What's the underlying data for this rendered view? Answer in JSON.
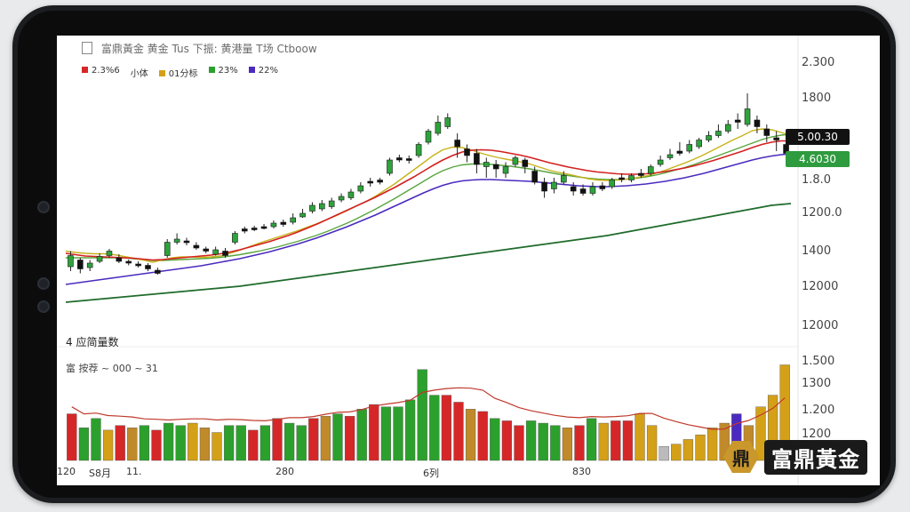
{
  "header": {
    "title": "富鼎黃金 黄金 Tus 下振: 黄港量 T场 Ctboow"
  },
  "legend": [
    {
      "label": "2.3%6",
      "color": "#d62728"
    },
    {
      "label": "小体",
      "color": "#d62728"
    },
    {
      "label": "01分标",
      "color": "#d4a017"
    },
    {
      "label": "23%",
      "color": "#2ca02c"
    },
    {
      "label": "22%",
      "color": "#4b2bbf"
    }
  ],
  "right_badges": [
    {
      "text": "5.00.30",
      "color": "#111111"
    },
    {
      "text": "4.6030",
      "color": "#2e9b3e"
    }
  ],
  "panel": {
    "subtitle": "4 应简量数",
    "volume_label": "富 按荐 ~ 000 ~ 31"
  },
  "x_ticks": [
    "120",
    "S8月",
    "11.",
    "280",
    "6列",
    "830"
  ],
  "brand": {
    "mark": "鼎",
    "name": "富鼎黃金"
  },
  "chart_data": {
    "type": "candlestick",
    "price_axis": {
      "ticks": [
        "2.300",
        "1800",
        "1.8.0",
        "1200.0",
        "1400",
        "12000",
        "12000"
      ]
    },
    "volume_axis": {
      "ticks": [
        "1.500",
        "1300",
        "1.200",
        "1200"
      ]
    },
    "candles": [
      {
        "o": 12.0,
        "c": 14.5,
        "h": 15.5,
        "l": 11.0,
        "dir": "up"
      },
      {
        "o": 13.5,
        "c": 11.5,
        "h": 14.0,
        "l": 10.5,
        "dir": "down"
      },
      {
        "o": 11.8,
        "c": 12.8,
        "h": 13.5,
        "l": 11.0,
        "dir": "up"
      },
      {
        "o": 13.2,
        "c": 14.3,
        "h": 15.0,
        "l": 12.8,
        "dir": "up"
      },
      {
        "o": 14.5,
        "c": 15.5,
        "h": 16.0,
        "l": 14.0,
        "dir": "up"
      },
      {
        "o": 14.0,
        "c": 13.2,
        "h": 14.8,
        "l": 12.8,
        "dir": "down"
      },
      {
        "o": 13.2,
        "c": 12.8,
        "h": 13.6,
        "l": 12.3,
        "dir": "down"
      },
      {
        "o": 12.6,
        "c": 12.2,
        "h": 13.2,
        "l": 11.8,
        "dir": "down"
      },
      {
        "o": 12.3,
        "c": 11.5,
        "h": 12.8,
        "l": 11.0,
        "dir": "down"
      },
      {
        "o": 11.2,
        "c": 10.5,
        "h": 11.8,
        "l": 10.2,
        "dir": "down"
      },
      {
        "o": 14.5,
        "c": 17.5,
        "h": 18.2,
        "l": 14.0,
        "dir": "up"
      },
      {
        "o": 17.5,
        "c": 18.2,
        "h": 19.5,
        "l": 17.0,
        "dir": "up"
      },
      {
        "o": 17.8,
        "c": 17.5,
        "h": 18.5,
        "l": 16.8,
        "dir": "down"
      },
      {
        "o": 16.8,
        "c": 16.2,
        "h": 17.5,
        "l": 15.8,
        "dir": "down"
      },
      {
        "o": 16.0,
        "c": 15.5,
        "h": 16.5,
        "l": 15.0,
        "dir": "down"
      },
      {
        "o": 14.8,
        "c": 15.8,
        "h": 16.5,
        "l": 14.5,
        "dir": "up"
      },
      {
        "o": 15.5,
        "c": 14.5,
        "h": 16.2,
        "l": 14.0,
        "dir": "down"
      },
      {
        "o": 17.5,
        "c": 19.5,
        "h": 20.0,
        "l": 17.0,
        "dir": "up"
      },
      {
        "o": 20.0,
        "c": 20.5,
        "h": 21.0,
        "l": 19.5,
        "dir": "down"
      },
      {
        "o": 20.4,
        "c": 20.7,
        "h": 21.2,
        "l": 20.0,
        "dir": "down"
      },
      {
        "o": 20.8,
        "c": 21.0,
        "h": 21.6,
        "l": 20.4,
        "dir": "down"
      },
      {
        "o": 21.0,
        "c": 21.8,
        "h": 22.4,
        "l": 20.6,
        "dir": "up"
      },
      {
        "o": 21.5,
        "c": 22.0,
        "h": 22.6,
        "l": 21.0,
        "dir": "down"
      },
      {
        "o": 22.0,
        "c": 23.0,
        "h": 24.0,
        "l": 21.5,
        "dir": "up"
      },
      {
        "o": 23.2,
        "c": 24.0,
        "h": 25.0,
        "l": 23.0,
        "dir": "up"
      },
      {
        "o": 24.5,
        "c": 25.8,
        "h": 26.5,
        "l": 24.0,
        "dir": "up"
      },
      {
        "o": 25.0,
        "c": 26.2,
        "h": 27.0,
        "l": 24.5,
        "dir": "up"
      },
      {
        "o": 25.5,
        "c": 26.8,
        "h": 27.5,
        "l": 25.0,
        "dir": "up"
      },
      {
        "o": 27.0,
        "c": 27.8,
        "h": 28.5,
        "l": 26.5,
        "dir": "up"
      },
      {
        "o": 27.5,
        "c": 28.8,
        "h": 29.5,
        "l": 27.0,
        "dir": "up"
      },
      {
        "o": 29.0,
        "c": 30.2,
        "h": 31.0,
        "l": 28.5,
        "dir": "up"
      },
      {
        "o": 30.8,
        "c": 31.2,
        "h": 32.0,
        "l": 30.0,
        "dir": "down"
      },
      {
        "o": 31.0,
        "c": 31.5,
        "h": 32.0,
        "l": 30.5,
        "dir": "down"
      },
      {
        "o": 33.0,
        "c": 36.0,
        "h": 36.5,
        "l": 32.5,
        "dir": "up"
      },
      {
        "o": 36.0,
        "c": 36.5,
        "h": 37.2,
        "l": 35.5,
        "dir": "down"
      },
      {
        "o": 36.0,
        "c": 36.3,
        "h": 37.0,
        "l": 35.2,
        "dir": "down"
      },
      {
        "o": 37.0,
        "c": 39.5,
        "h": 40.0,
        "l": 36.5,
        "dir": "up"
      },
      {
        "o": 40.0,
        "c": 42.5,
        "h": 43.0,
        "l": 39.5,
        "dir": "up"
      },
      {
        "o": 42.0,
        "c": 44.5,
        "h": 46.0,
        "l": 41.5,
        "dir": "up"
      },
      {
        "o": 43.5,
        "c": 45.5,
        "h": 46.5,
        "l": 43.0,
        "dir": "up"
      },
      {
        "o": 40.5,
        "c": 39.0,
        "h": 42.0,
        "l": 36.5,
        "dir": "down"
      },
      {
        "o": 38.5,
        "c": 37.0,
        "h": 39.5,
        "l": 35.5,
        "dir": "down"
      },
      {
        "o": 37.5,
        "c": 35.0,
        "h": 38.5,
        "l": 33.0,
        "dir": "down"
      },
      {
        "o": 34.5,
        "c": 35.5,
        "h": 36.5,
        "l": 32.0,
        "dir": "up"
      },
      {
        "o": 35.0,
        "c": 34.0,
        "h": 36.0,
        "l": 32.0,
        "dir": "down"
      },
      {
        "o": 33.0,
        "c": 34.5,
        "h": 35.5,
        "l": 32.0,
        "dir": "up"
      },
      {
        "o": 35.0,
        "c": 36.5,
        "h": 37.0,
        "l": 34.5,
        "dir": "up"
      },
      {
        "o": 36.0,
        "c": 34.5,
        "h": 36.5,
        "l": 33.0,
        "dir": "down"
      },
      {
        "o": 33.5,
        "c": 31.0,
        "h": 34.5,
        "l": 30.5,
        "dir": "down"
      },
      {
        "o": 31.0,
        "c": 29.0,
        "h": 32.0,
        "l": 27.5,
        "dir": "down"
      },
      {
        "o": 29.5,
        "c": 31.0,
        "h": 32.0,
        "l": 28.5,
        "dir": "up"
      },
      {
        "o": 31.0,
        "c": 32.5,
        "h": 33.5,
        "l": 30.5,
        "dir": "up"
      },
      {
        "o": 30.0,
        "c": 29.0,
        "h": 31.0,
        "l": 28.0,
        "dir": "down"
      },
      {
        "o": 29.5,
        "c": 28.5,
        "h": 30.5,
        "l": 28.0,
        "dir": "down"
      },
      {
        "o": 28.5,
        "c": 30.0,
        "h": 31.0,
        "l": 28.0,
        "dir": "up"
      },
      {
        "o": 29.5,
        "c": 30.2,
        "h": 31.0,
        "l": 29.0,
        "dir": "down"
      },
      {
        "o": 30.0,
        "c": 31.5,
        "h": 32.0,
        "l": 29.5,
        "dir": "up"
      },
      {
        "o": 31.8,
        "c": 32.0,
        "h": 33.0,
        "l": 31.0,
        "dir": "down"
      },
      {
        "o": 31.5,
        "c": 32.5,
        "h": 33.0,
        "l": 31.0,
        "dir": "up"
      },
      {
        "o": 32.5,
        "c": 33.0,
        "h": 34.0,
        "l": 32.0,
        "dir": "down"
      },
      {
        "o": 33.0,
        "c": 34.5,
        "h": 35.0,
        "l": 32.5,
        "dir": "up"
      },
      {
        "o": 35.0,
        "c": 36.0,
        "h": 37.0,
        "l": 34.5,
        "dir": "up"
      },
      {
        "o": 36.5,
        "c": 37.2,
        "h": 38.5,
        "l": 36.0,
        "dir": "up"
      },
      {
        "o": 37.5,
        "c": 38.0,
        "h": 40.0,
        "l": 37.0,
        "dir": "down"
      },
      {
        "o": 38.0,
        "c": 39.5,
        "h": 40.5,
        "l": 37.5,
        "dir": "up"
      },
      {
        "o": 39.0,
        "c": 40.5,
        "h": 41.0,
        "l": 38.5,
        "dir": "up"
      },
      {
        "o": 40.5,
        "c": 41.5,
        "h": 42.5,
        "l": 40.0,
        "dir": "up"
      },
      {
        "o": 41.5,
        "c": 42.5,
        "h": 44.0,
        "l": 41.0,
        "dir": "up"
      },
      {
        "o": 42.5,
        "c": 44.0,
        "h": 45.0,
        "l": 42.0,
        "dir": "up"
      },
      {
        "o": 45.0,
        "c": 44.5,
        "h": 46.5,
        "l": 43.0,
        "dir": "down"
      },
      {
        "o": 44.0,
        "c": 47.5,
        "h": 51.0,
        "l": 43.5,
        "dir": "up"
      },
      {
        "o": 45.0,
        "c": 43.5,
        "h": 46.0,
        "l": 42.0,
        "dir": "down"
      },
      {
        "o": 43.0,
        "c": 41.5,
        "h": 44.0,
        "l": 40.0,
        "dir": "down"
      },
      {
        "o": 40.5,
        "c": 41.0,
        "h": 42.5,
        "l": 38.0,
        "dir": "down"
      },
      {
        "o": 39.5,
        "c": 37.5,
        "h": 40.5,
        "l": 35.0,
        "dir": "down"
      }
    ],
    "ma_red": [
      15.0,
      14.7,
      14.4,
      14.3,
      14.2,
      14.1,
      14.0,
      13.9,
      13.7,
      13.5,
      13.6,
      13.8,
      14.0,
      14.2,
      14.4,
      14.6,
      14.9,
      15.3,
      15.8,
      16.4,
      17.0,
      17.6,
      18.3,
      19.0,
      19.8,
      20.7,
      21.6,
      22.6,
      23.6,
      24.6,
      25.6,
      26.6,
      27.6,
      28.7,
      29.8,
      31.0,
      32.2,
      33.5,
      34.8,
      36.0,
      37.0,
      37.8,
      38.2,
      38.3,
      38.2,
      37.9,
      37.5,
      37.1,
      36.6,
      36.0,
      35.4,
      34.9,
      34.4,
      34.0,
      33.6,
      33.3,
      33.1,
      32.9,
      32.8,
      32.8,
      32.9,
      33.1,
      33.4,
      33.8,
      34.2,
      34.7,
      35.3,
      35.9,
      36.6,
      37.3,
      38.0,
      38.8,
      39.5,
      40.0,
      40.3,
      40.3
    ],
    "ma_yellow": [
      15.5,
      15.2,
      15.0,
      14.9,
      14.9,
      14.7,
      14.3,
      13.9,
      13.5,
      13.0,
      13.5,
      14.0,
      14.2,
      14.2,
      14.1,
      14.2,
      14.4,
      15.0,
      15.7,
      16.5,
      17.3,
      18.0,
      18.7,
      19.4,
      20.1,
      20.9,
      21.7,
      22.6,
      23.5,
      24.5,
      25.6,
      26.6,
      27.8,
      29.2,
      30.6,
      32.2,
      33.8,
      35.4,
      37.0,
      38.3,
      38.9,
      38.8,
      38.2,
      37.5,
      36.9,
      36.4,
      36.0,
      35.6,
      35.1,
      34.4,
      33.7,
      33.2,
      32.8,
      32.3,
      31.8,
      31.5,
      31.4,
      31.5,
      31.7,
      32.0,
      32.4,
      33.0,
      33.7,
      34.5,
      35.3,
      36.2,
      37.2,
      38.3,
      39.4,
      40.5,
      41.5,
      42.6,
      43.0,
      42.8,
      42.2,
      41.5
    ],
    "ma_green": [
      14.0,
      14.0,
      14.0,
      14.0,
      14.0,
      14.0,
      14.0,
      13.8,
      13.6,
      13.4,
      13.4,
      13.5,
      13.6,
      13.7,
      13.8,
      13.9,
      14.1,
      14.4,
      14.7,
      15.1,
      15.5,
      16.0,
      16.5,
      17.1,
      17.7,
      18.4,
      19.1,
      19.9,
      20.8,
      21.7,
      22.7,
      23.8,
      24.9,
      26.1,
      27.3,
      28.6,
      29.9,
      31.2,
      32.5,
      33.6,
      34.4,
      34.9,
      35.1,
      35.1,
      35.0,
      34.8,
      34.6,
      34.3,
      34.0,
      33.6,
      33.2,
      32.8,
      32.5,
      32.2,
      31.9,
      31.7,
      31.6,
      31.6,
      31.7,
      31.9,
      32.2,
      32.6,
      33.1,
      33.7,
      34.3,
      35.0,
      35.8,
      36.6,
      37.4,
      38.2,
      39.0,
      39.8,
      40.6,
      41.2,
      41.6,
      41.8
    ],
    "ma_purple": [
      8.0,
      8.3,
      8.6,
      8.9,
      9.2,
      9.5,
      9.8,
      10.1,
      10.4,
      10.7,
      11.0,
      11.3,
      11.6,
      11.9,
      12.2,
      12.6,
      13.0,
      13.4,
      13.8,
      14.3,
      14.8,
      15.3,
      15.9,
      16.5,
      17.1,
      17.8,
      18.5,
      19.3,
      20.1,
      20.9,
      21.8,
      22.7,
      23.6,
      24.6,
      25.6,
      26.6,
      27.6,
      28.6,
      29.5,
      30.3,
      30.9,
      31.3,
      31.5,
      31.6,
      31.6,
      31.5,
      31.4,
      31.3,
      31.2,
      31.0,
      30.8,
      30.6,
      30.4,
      30.2,
      30.1,
      30.0,
      30.0,
      30.1,
      30.2,
      30.4,
      30.6,
      30.9,
      31.2,
      31.6,
      32.0,
      32.5,
      33.0,
      33.6,
      34.2,
      34.8,
      35.4,
      36.0,
      36.5,
      36.9,
      37.2,
      37.4
    ],
    "ma_darkgreen": [
      4.0,
      4.2,
      4.4,
      4.6,
      4.8,
      5.0,
      5.2,
      5.4,
      5.6,
      5.8,
      6.0,
      6.2,
      6.4,
      6.6,
      6.8,
      7.0,
      7.2,
      7.4,
      7.6,
      7.9,
      8.2,
      8.5,
      8.8,
      9.1,
      9.4,
      9.7,
      10.0,
      10.3,
      10.6,
      10.9,
      11.2,
      11.5,
      11.8,
      12.1,
      12.4,
      12.7,
      13.0,
      13.3,
      13.6,
      13.9,
      14.2,
      14.5,
      14.8,
      15.1,
      15.4,
      15.7,
      16.0,
      16.3,
      16.6,
      16.9,
      17.2,
      17.5,
      17.8,
      18.1,
      18.4,
      18.7,
      19.0,
      19.4,
      19.8,
      20.2,
      20.6,
      21.0,
      21.4,
      21.8,
      22.2,
      22.6,
      23.0,
      23.4,
      23.8,
      24.2,
      24.6,
      25.0,
      25.4,
      25.8,
      26.0,
      26.2
    ],
    "volume": [
      {
        "v": 40,
        "c": "#d62728"
      },
      {
        "v": 28,
        "c": "#2ca02c"
      },
      {
        "v": 36,
        "c": "#2ca02c"
      },
      {
        "v": 26,
        "c": "#d4a017"
      },
      {
        "v": 30,
        "c": "#d62728"
      },
      {
        "v": 28,
        "c": "#c08a2a"
      },
      {
        "v": 30,
        "c": "#2ca02c"
      },
      {
        "v": 26,
        "c": "#d62728"
      },
      {
        "v": 32,
        "c": "#2ca02c"
      },
      {
        "v": 30,
        "c": "#2ca02c"
      },
      {
        "v": 32,
        "c": "#d4a017"
      },
      {
        "v": 28,
        "c": "#c08a2a"
      },
      {
        "v": 24,
        "c": "#d4a017"
      },
      {
        "v": 30,
        "c": "#2ca02c"
      },
      {
        "v": 30,
        "c": "#2ca02c"
      },
      {
        "v": 26,
        "c": "#d62728"
      },
      {
        "v": 30,
        "c": "#2ca02c"
      },
      {
        "v": 36,
        "c": "#d62728"
      },
      {
        "v": 32,
        "c": "#2ca02c"
      },
      {
        "v": 30,
        "c": "#2ca02c"
      },
      {
        "v": 36,
        "c": "#d62728"
      },
      {
        "v": 38,
        "c": "#c08a2a"
      },
      {
        "v": 40,
        "c": "#2ca02c"
      },
      {
        "v": 38,
        "c": "#d62728"
      },
      {
        "v": 44,
        "c": "#2ca02c"
      },
      {
        "v": 48,
        "c": "#d62728"
      },
      {
        "v": 46,
        "c": "#2ca02c"
      },
      {
        "v": 46,
        "c": "#2ca02c"
      },
      {
        "v": 52,
        "c": "#2ca02c"
      },
      {
        "v": 78,
        "c": "#2ca02c"
      },
      {
        "v": 56,
        "c": "#2ca02c"
      },
      {
        "v": 56,
        "c": "#d62728"
      },
      {
        "v": 50,
        "c": "#d62728"
      },
      {
        "v": 44,
        "c": "#c08a2a"
      },
      {
        "v": 42,
        "c": "#d62728"
      },
      {
        "v": 36,
        "c": "#2ca02c"
      },
      {
        "v": 34,
        "c": "#d62728"
      },
      {
        "v": 30,
        "c": "#d62728"
      },
      {
        "v": 34,
        "c": "#2ca02c"
      },
      {
        "v": 32,
        "c": "#2ca02c"
      },
      {
        "v": 30,
        "c": "#2ca02c"
      },
      {
        "v": 28,
        "c": "#c08a2a"
      },
      {
        "v": 30,
        "c": "#d62728"
      },
      {
        "v": 36,
        "c": "#2ca02c"
      },
      {
        "v": 32,
        "c": "#d4a017"
      },
      {
        "v": 34,
        "c": "#d62728"
      },
      {
        "v": 34,
        "c": "#d62728"
      },
      {
        "v": 40,
        "c": "#d4a017"
      },
      {
        "v": 30,
        "c": "#d4a017"
      },
      {
        "v": 12,
        "c": "#bbbbbb"
      },
      {
        "v": 14,
        "c": "#d4a017"
      },
      {
        "v": 18,
        "c": "#d4a017"
      },
      {
        "v": 22,
        "c": "#d4a017"
      },
      {
        "v": 28,
        "c": "#d4a017"
      },
      {
        "v": 32,
        "c": "#c08a2a"
      },
      {
        "v": 40,
        "c": "#4b2bbf"
      },
      {
        "v": 30,
        "c": "#c08a2a"
      },
      {
        "v": 46,
        "c": "#d4a017"
      },
      {
        "v": 56,
        "c": "#d4a017"
      },
      {
        "v": 82,
        "c": "#d4a017"
      }
    ]
  }
}
